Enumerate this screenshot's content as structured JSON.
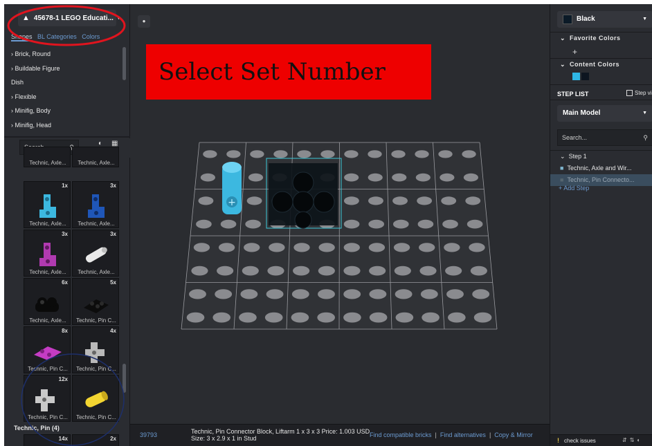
{
  "set_selector": {
    "label": "45678-1 LEGO Educati..."
  },
  "left_tabs": [
    "Shapes",
    "BL Categories",
    "Colors"
  ],
  "categories": [
    "› Brick, Round",
    "› Buildable Figure",
    "Dish",
    "› Flexible",
    "› Minifig, Body",
    "› Minifig, Head"
  ],
  "parts_search": {
    "placeholder": "Search..."
  },
  "parts": [
    {
      "name": "Technic, Axle...",
      "qty": ""
    },
    {
      "name": "Technic, Axle...",
      "qty": ""
    },
    {
      "name": "Technic, Axle...",
      "qty": "1x"
    },
    {
      "name": "Technic, Axle...",
      "qty": "3x"
    },
    {
      "name": "Technic, Axle...",
      "qty": "3x"
    },
    {
      "name": "Technic, Axle...",
      "qty": "3x"
    },
    {
      "name": "Technic, Axle...",
      "qty": "6x"
    },
    {
      "name": "Technic, Pin C...",
      "qty": "5x"
    },
    {
      "name": "Technic, Pin C...",
      "qty": "8x"
    },
    {
      "name": "Technic, Pin C...",
      "qty": "4x"
    },
    {
      "name": "Technic, Pin C...",
      "qty": "12x"
    },
    {
      "name": "Technic, Pin C...",
      "qty": ""
    },
    {
      "name": "",
      "qty": "14x"
    },
    {
      "name": "",
      "qty": "2x"
    }
  ],
  "group_label": "Technic, Pin (4)",
  "overlay_label": "Select Set Number",
  "status": {
    "part_number": "39793",
    "description": "Technic, Pin Connector Block, Liftarm 1 x 3 x 3   Price: 1.003 USD   Size: 3 x 2.9 x 1 in Stud",
    "links": [
      "Find compatible bricks",
      "Find alternatives",
      "Copy & Mirror"
    ]
  },
  "right": {
    "color": "Black",
    "favorite_colors": "Favorite Colors",
    "content_colors": "Content Colors",
    "content_swatches": [
      "#2fb7e6",
      "#0d1520"
    ],
    "step_list": "STEP LIST",
    "step_view": "Step view",
    "model": "Main Model",
    "search_placeholder": "Search...",
    "steps": [
      {
        "label": "Step 1",
        "prefix": "⌄"
      },
      {
        "label": "Technic, Axle and Wir...",
        "prefix": "■"
      },
      {
        "label": "Technic, Pin Connecto...",
        "prefix": "■"
      }
    ],
    "add_step": "+ Add Step",
    "status": "check issues"
  },
  "colors": {
    "annotation_red": "#e0141e",
    "annotation_blue": "#1d2f6b",
    "link_blue": "#6c9bd1",
    "axle_cyan": "#3cb8e0",
    "grid_plate": "#3d3e43",
    "stud": "#8a8b8f"
  }
}
